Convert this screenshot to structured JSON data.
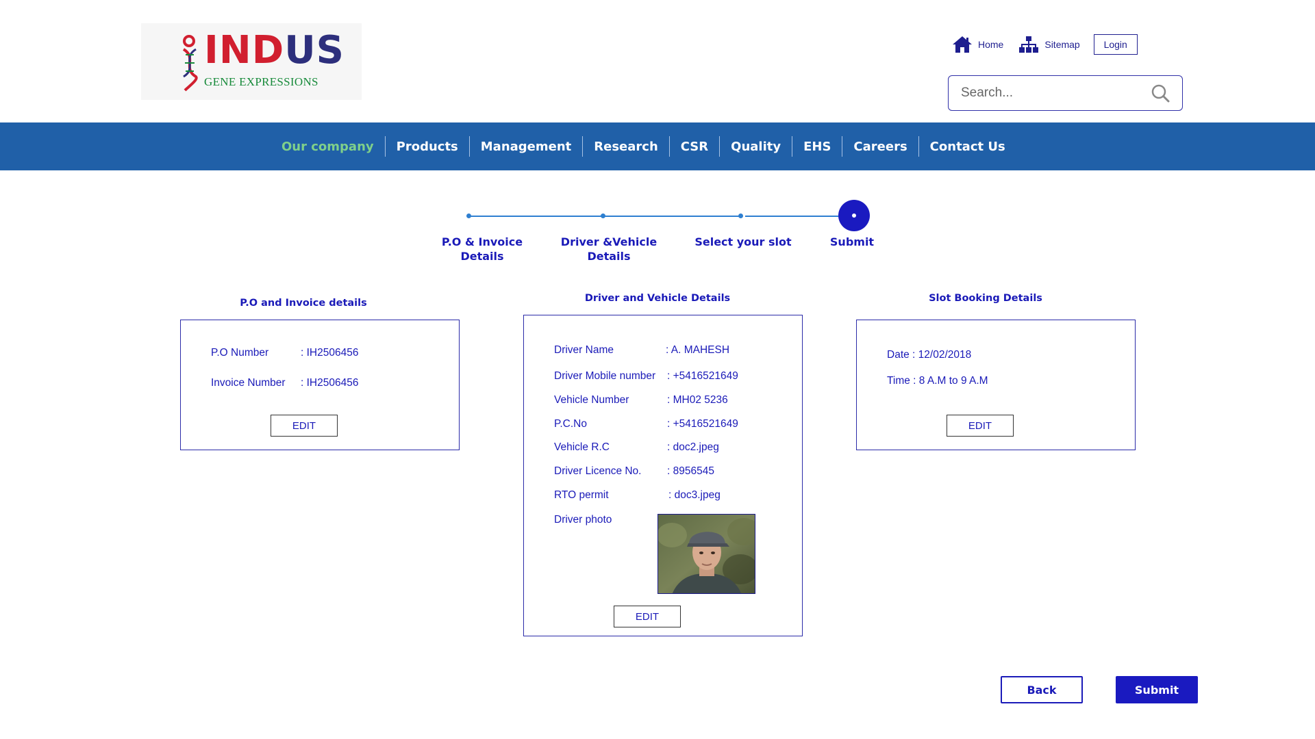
{
  "brand": {
    "name_part1": "IN",
    "name_part2": "D",
    "name_part3": "US",
    "tagline": "GENE EXPRESSIONS",
    "colors": {
      "red": "#d11f2f",
      "navy": "#2d2f7c",
      "green": "#178a3a"
    }
  },
  "top_links": {
    "home": {
      "label": "Home",
      "icon": "home-icon"
    },
    "sitemap": {
      "label": "Sitemap",
      "icon": "sitemap-icon"
    },
    "login": "Login"
  },
  "search": {
    "placeholder": "Search...",
    "icon": "search-icon"
  },
  "nav": {
    "background": "#2060a8",
    "active_color": "#7fd08a",
    "items": [
      {
        "label": "Our company",
        "active": true
      },
      {
        "label": "Products"
      },
      {
        "label": "Management"
      },
      {
        "label": "Research"
      },
      {
        "label": "CSR"
      },
      {
        "label": "Quality"
      },
      {
        "label": "EHS"
      },
      {
        "label": "Careers"
      },
      {
        "label": "Contact Us"
      }
    ]
  },
  "stepper": {
    "current_step": 4,
    "steps": [
      {
        "line1": "P.O & Invoice",
        "line2": "Details"
      },
      {
        "line1": "Driver &Vehicle",
        "line2": "Details"
      },
      {
        "line1": "Select your slot",
        "line2": ""
      },
      {
        "line1": "Submit",
        "line2": ""
      }
    ]
  },
  "po_card": {
    "title": "P.O and Invoice details",
    "rows": [
      {
        "label": "P.O Number",
        "value": ": IH2506456"
      },
      {
        "label": "Invoice Number",
        "value": ": IH2506456"
      }
    ],
    "edit": "EDIT"
  },
  "driver_card": {
    "title": "Driver and Vehicle Details",
    "rows": [
      {
        "label": "Driver Name",
        "value": ": A. MAHESH"
      },
      {
        "label": "Driver Mobile number",
        "value": ":  +5416521649"
      },
      {
        "label": "Vehicle Number",
        "value": ":   MH02 5236"
      },
      {
        "label": "P.C.No",
        "value": ":   +5416521649"
      },
      {
        "label": "Vehicle R.C",
        "value": ":   doc2.jpeg"
      },
      {
        "label": "Driver Licence No.",
        "value": ": 8956545"
      },
      {
        "label": "RTO permit",
        "value": ":   doc3.jpeg"
      },
      {
        "label": "Driver photo",
        "value": ""
      }
    ],
    "edit": "EDIT"
  },
  "slot_card": {
    "title": "Slot Booking Details",
    "rows": [
      {
        "text": "Date  : 12/02/2018"
      },
      {
        "text": "Time : 8 A.M to 9 A.M"
      }
    ],
    "edit": "EDIT"
  },
  "actions": {
    "back": "Back",
    "submit": "Submit"
  }
}
